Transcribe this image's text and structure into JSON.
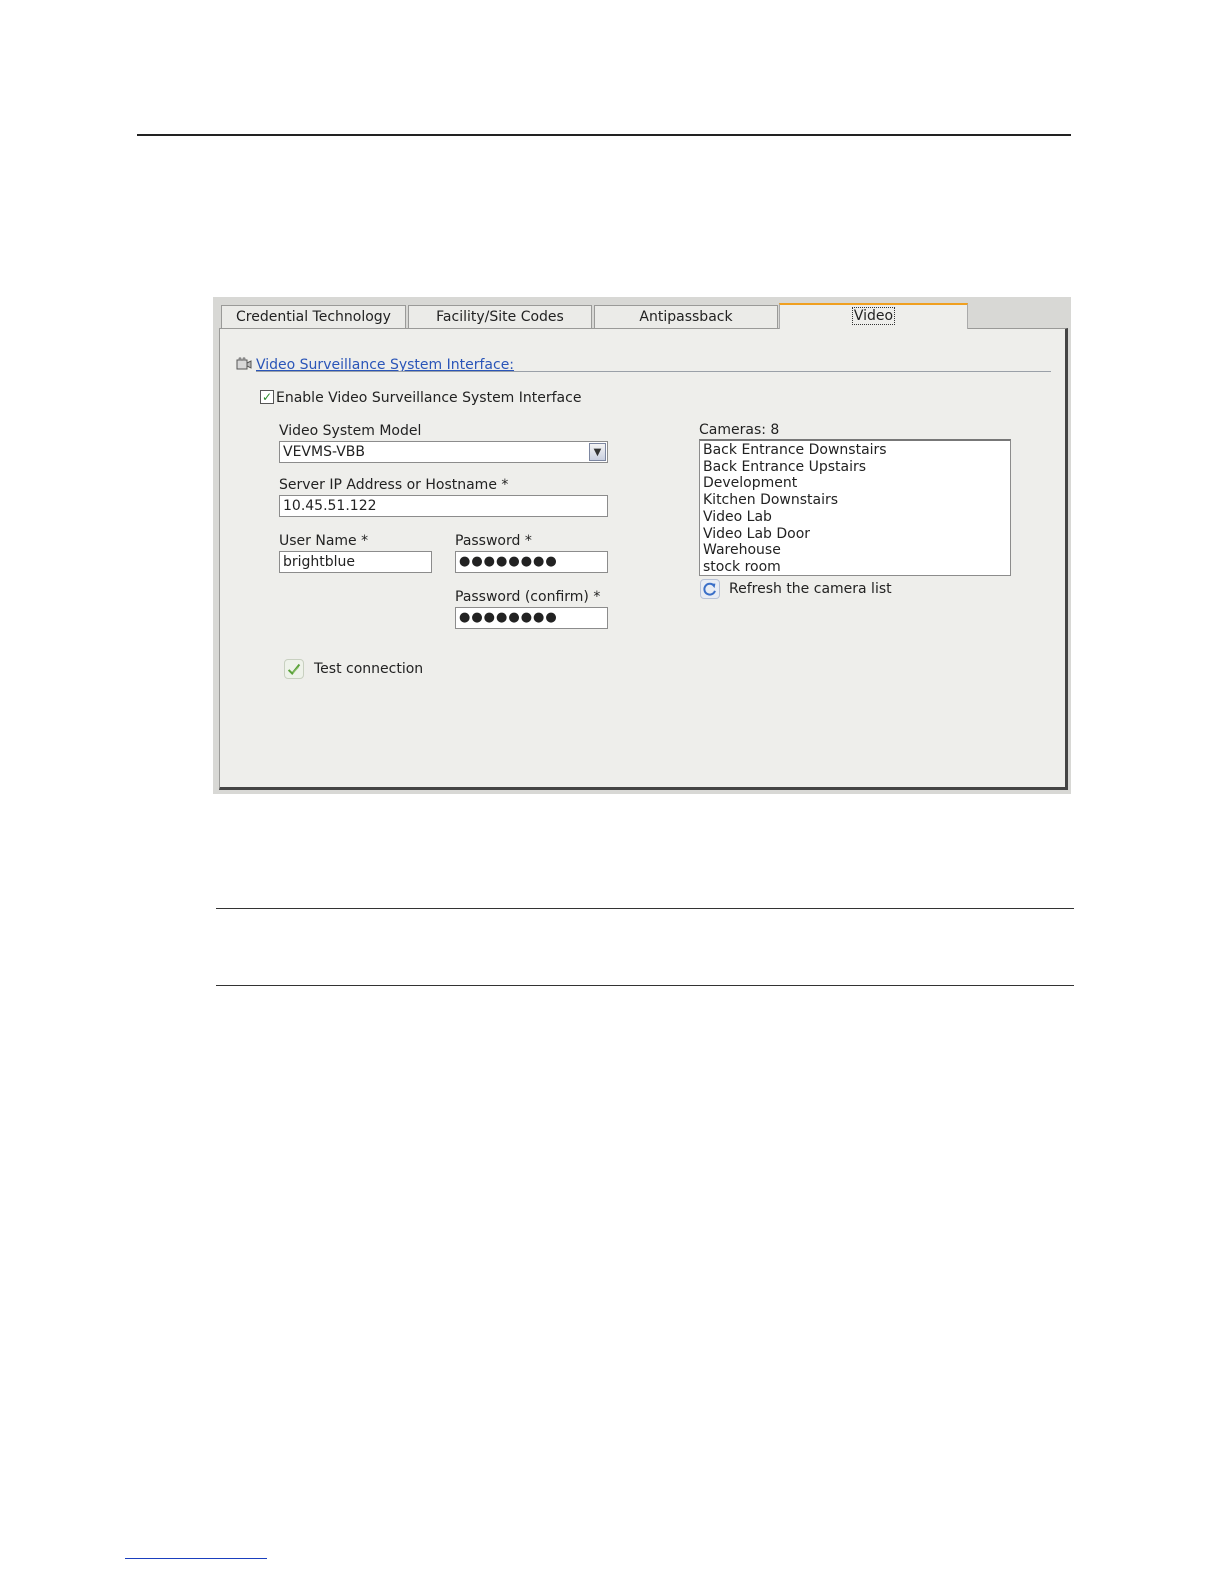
{
  "tabs": [
    {
      "label": "Credential Technology"
    },
    {
      "label": "Facility/Site Codes"
    },
    {
      "label": "Antipassback"
    },
    {
      "label": "Video"
    }
  ],
  "section": {
    "title": "Video Surveillance System Interface:",
    "icon": "video-camera-icon"
  },
  "enable": {
    "label": "Enable Video Surveillance System Interface",
    "checked": true
  },
  "model": {
    "label": "Video System Model",
    "value": "VEVMS-VBB"
  },
  "server": {
    "label": "Server IP Address or Hostname *",
    "value": "10.45.51.122"
  },
  "username": {
    "label": "User Name *",
    "value": "brightblue"
  },
  "password": {
    "label": "Password *",
    "value": "●●●●●●●●"
  },
  "password_confirm": {
    "label": "Password (confirm) *",
    "value": "●●●●●●●●"
  },
  "test_connection": {
    "label": "Test connection",
    "icon": "check-pencil-icon"
  },
  "cameras": {
    "label": "Cameras: 8",
    "items": [
      "Back Entrance Downstairs",
      "Back Entrance Upstairs",
      "Development",
      "Kitchen Downstairs",
      "Video Lab",
      "Video Lab Door",
      "Warehouse",
      "stock room"
    ],
    "refresh_label": "Refresh the camera list",
    "refresh_icon": "refresh-icon"
  },
  "colors": {
    "link": "#2a55b8",
    "active_tab_accent": "#f0a020",
    "panel_bg": "#eeeeeb"
  }
}
